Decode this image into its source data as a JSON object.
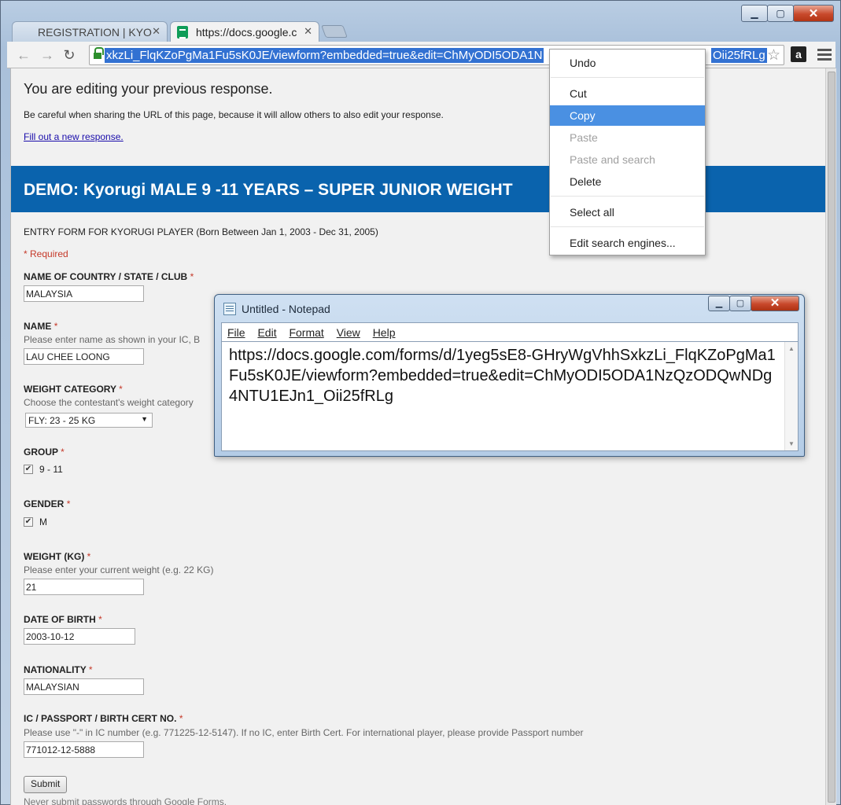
{
  "browser": {
    "tabs": [
      {
        "label": "REGISTRATION | KYO"
      },
      {
        "label": "https://docs.google.c"
      }
    ],
    "url_visible": "xkzLi_FlqKZoPgMa1Fu5sK0JE/viewform?embedded=true&edit=ChMyODI5ODA1N",
    "url_tail": "Oii25fRLg",
    "amazon_label": "a"
  },
  "form": {
    "edit_notice": "You are editing your previous response.",
    "edit_warning": "Be careful when sharing the URL of this page, because it will allow others to also edit your response.",
    "new_response_link": "Fill out a new response.",
    "title": "DEMO: Kyorugi MALE 9 -11 YEARS – SUPER JUNIOR WEIGHT",
    "description": "ENTRY FORM FOR KYORUGI PLAYER (Born Between Jan 1, 2003 -  Dec 31, 2005)",
    "required_note": "* Required",
    "required_mark": "*",
    "questions": {
      "country": {
        "label": "NAME OF COUNTRY / STATE / CLUB",
        "value": "MALAYSIA"
      },
      "name": {
        "label": "NAME",
        "help": "Please enter name as shown in your IC, B",
        "value": "LAU CHEE LOONG"
      },
      "weight_category": {
        "label": "WEIGHT CATEGORY",
        "help": "Choose the contestant's weight category",
        "value": "FLY: 23 - 25 KG"
      },
      "group": {
        "label": "GROUP",
        "option": "9 - 11",
        "checked": true
      },
      "gender": {
        "label": "GENDER",
        "option": "M",
        "checked": true
      },
      "weight": {
        "label": "WEIGHT (KG)",
        "help": "Please enter your current weight (e.g. 22 KG)",
        "value": "21"
      },
      "dob": {
        "label": "DATE OF BIRTH",
        "value": "2003-10-12"
      },
      "nationality": {
        "label": "NATIONALITY",
        "value": "MALAYSIAN"
      },
      "ic": {
        "label": "IC / PASSPORT / BIRTH CERT NO.",
        "help": "Please use \"-\" in IC number (e.g. 771225-12-5147). If no IC, enter Birth Cert. For international player, please provide Passport number",
        "value": "771012-12-5888"
      }
    },
    "submit_label": "Submit",
    "never_submit": "Never submit passwords through Google Forms."
  },
  "context_menu": {
    "items": [
      {
        "label": "Undo",
        "enabled": true
      },
      {
        "label": "Cut",
        "enabled": true
      },
      {
        "label": "Copy",
        "enabled": true,
        "highlighted": true
      },
      {
        "label": "Paste",
        "enabled": false
      },
      {
        "label": "Paste and search",
        "enabled": false
      },
      {
        "label": "Delete",
        "enabled": true
      },
      {
        "label": "Select all",
        "enabled": true
      },
      {
        "label": "Edit search engines...",
        "enabled": true
      }
    ]
  },
  "notepad": {
    "title": "Untitled - Notepad",
    "menu": [
      "File",
      "Edit",
      "Format",
      "View",
      "Help"
    ],
    "content": "https://docs.google.com/forms/d/1yeg5sE8-GHryWgVhhSxkzLi_FlqKZoPgMa1Fu5sK0JE/viewform?embedded=true&edit=ChMyODI5ODA1NzQzODQwNDg4NTU1EJn1_Oii25fRLg"
  },
  "colors": {
    "header_blue": "#0a63ad",
    "required_red": "#c53929",
    "highlight_blue": "#4a90e2",
    "url_selection": "#3271d2"
  }
}
